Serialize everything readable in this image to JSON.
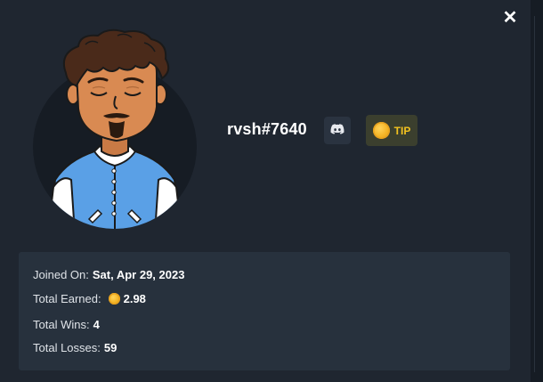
{
  "profile": {
    "username": "rvsh#7640",
    "tip_label": "TIP"
  },
  "icons": {
    "close": "close-icon",
    "discord": "discord-icon",
    "coin": "coin-icon",
    "avatar": "avatar-illustration"
  },
  "colors": {
    "background": "#1f2630",
    "stats_panel": "#27313d",
    "tip_button_bg": "#3b3f2e",
    "tip_accent": "#f3c21f",
    "jacket": "#5aa0e6"
  },
  "stats": {
    "joined_label": "Joined On:",
    "joined_value": "Sat, Apr 29, 2023",
    "earned_label": "Total Earned:",
    "earned_value": "2.98",
    "wins_label": "Total Wins:",
    "wins_value": "4",
    "losses_label": "Total Losses:",
    "losses_value": "59"
  }
}
